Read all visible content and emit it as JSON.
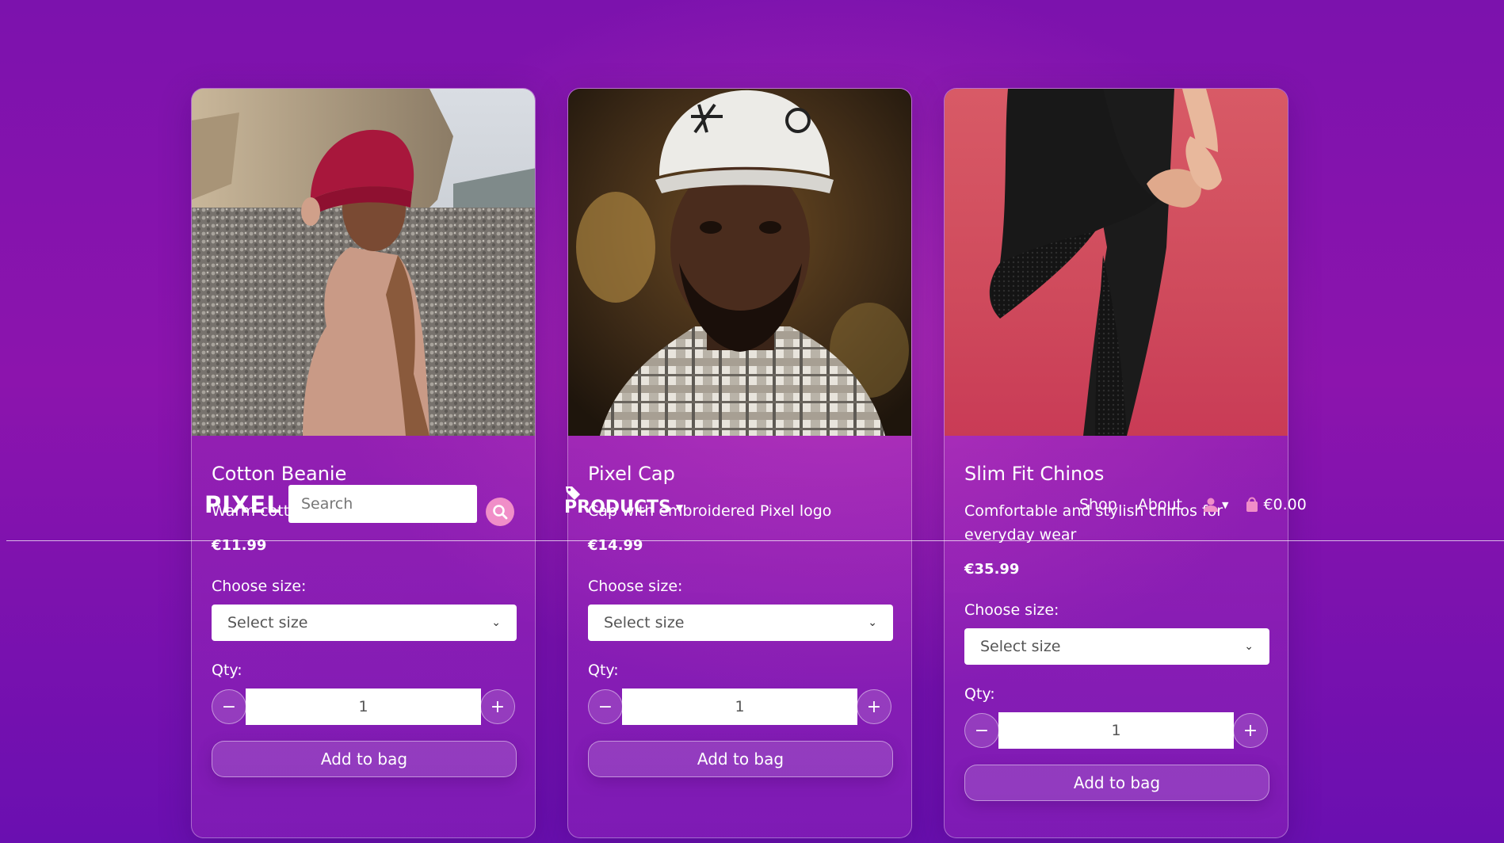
{
  "header": {
    "logo": "PIXEL",
    "search_placeholder": "Search",
    "products_menu": "PRODUCTS",
    "nav_shop": "Shop",
    "nav_about": "About",
    "bag_total": "€0.00"
  },
  "products": [
    {
      "title": "Cotton Beanie",
      "description": "Warm cotton beanie",
      "price": "€11.99",
      "size_label": "Choose size:",
      "size_selected": "Select size",
      "qty_label": "Qty:",
      "qty_value": "1",
      "minus": "−",
      "plus": "+",
      "add_button": "Add to bag"
    },
    {
      "title": "Pixel Cap",
      "description": "Cap with embroidered Pixel logo",
      "price": "€14.99",
      "size_label": "Choose size:",
      "size_selected": "Select size",
      "qty_label": "Qty:",
      "qty_value": "1",
      "minus": "−",
      "plus": "+",
      "add_button": "Add to bag"
    },
    {
      "title": "Slim Fit Chinos",
      "description": "Comfortable and stylish chinos for everyday wear",
      "price": "€35.99",
      "size_label": "Choose size:",
      "size_selected": "Select size",
      "qty_label": "Qty:",
      "qty_value": "1",
      "minus": "−",
      "plus": "+",
      "add_button": "Add to bag"
    }
  ],
  "colors": {
    "accent_pink": "#f08ec8",
    "bg_purple": "#7c12ad"
  }
}
